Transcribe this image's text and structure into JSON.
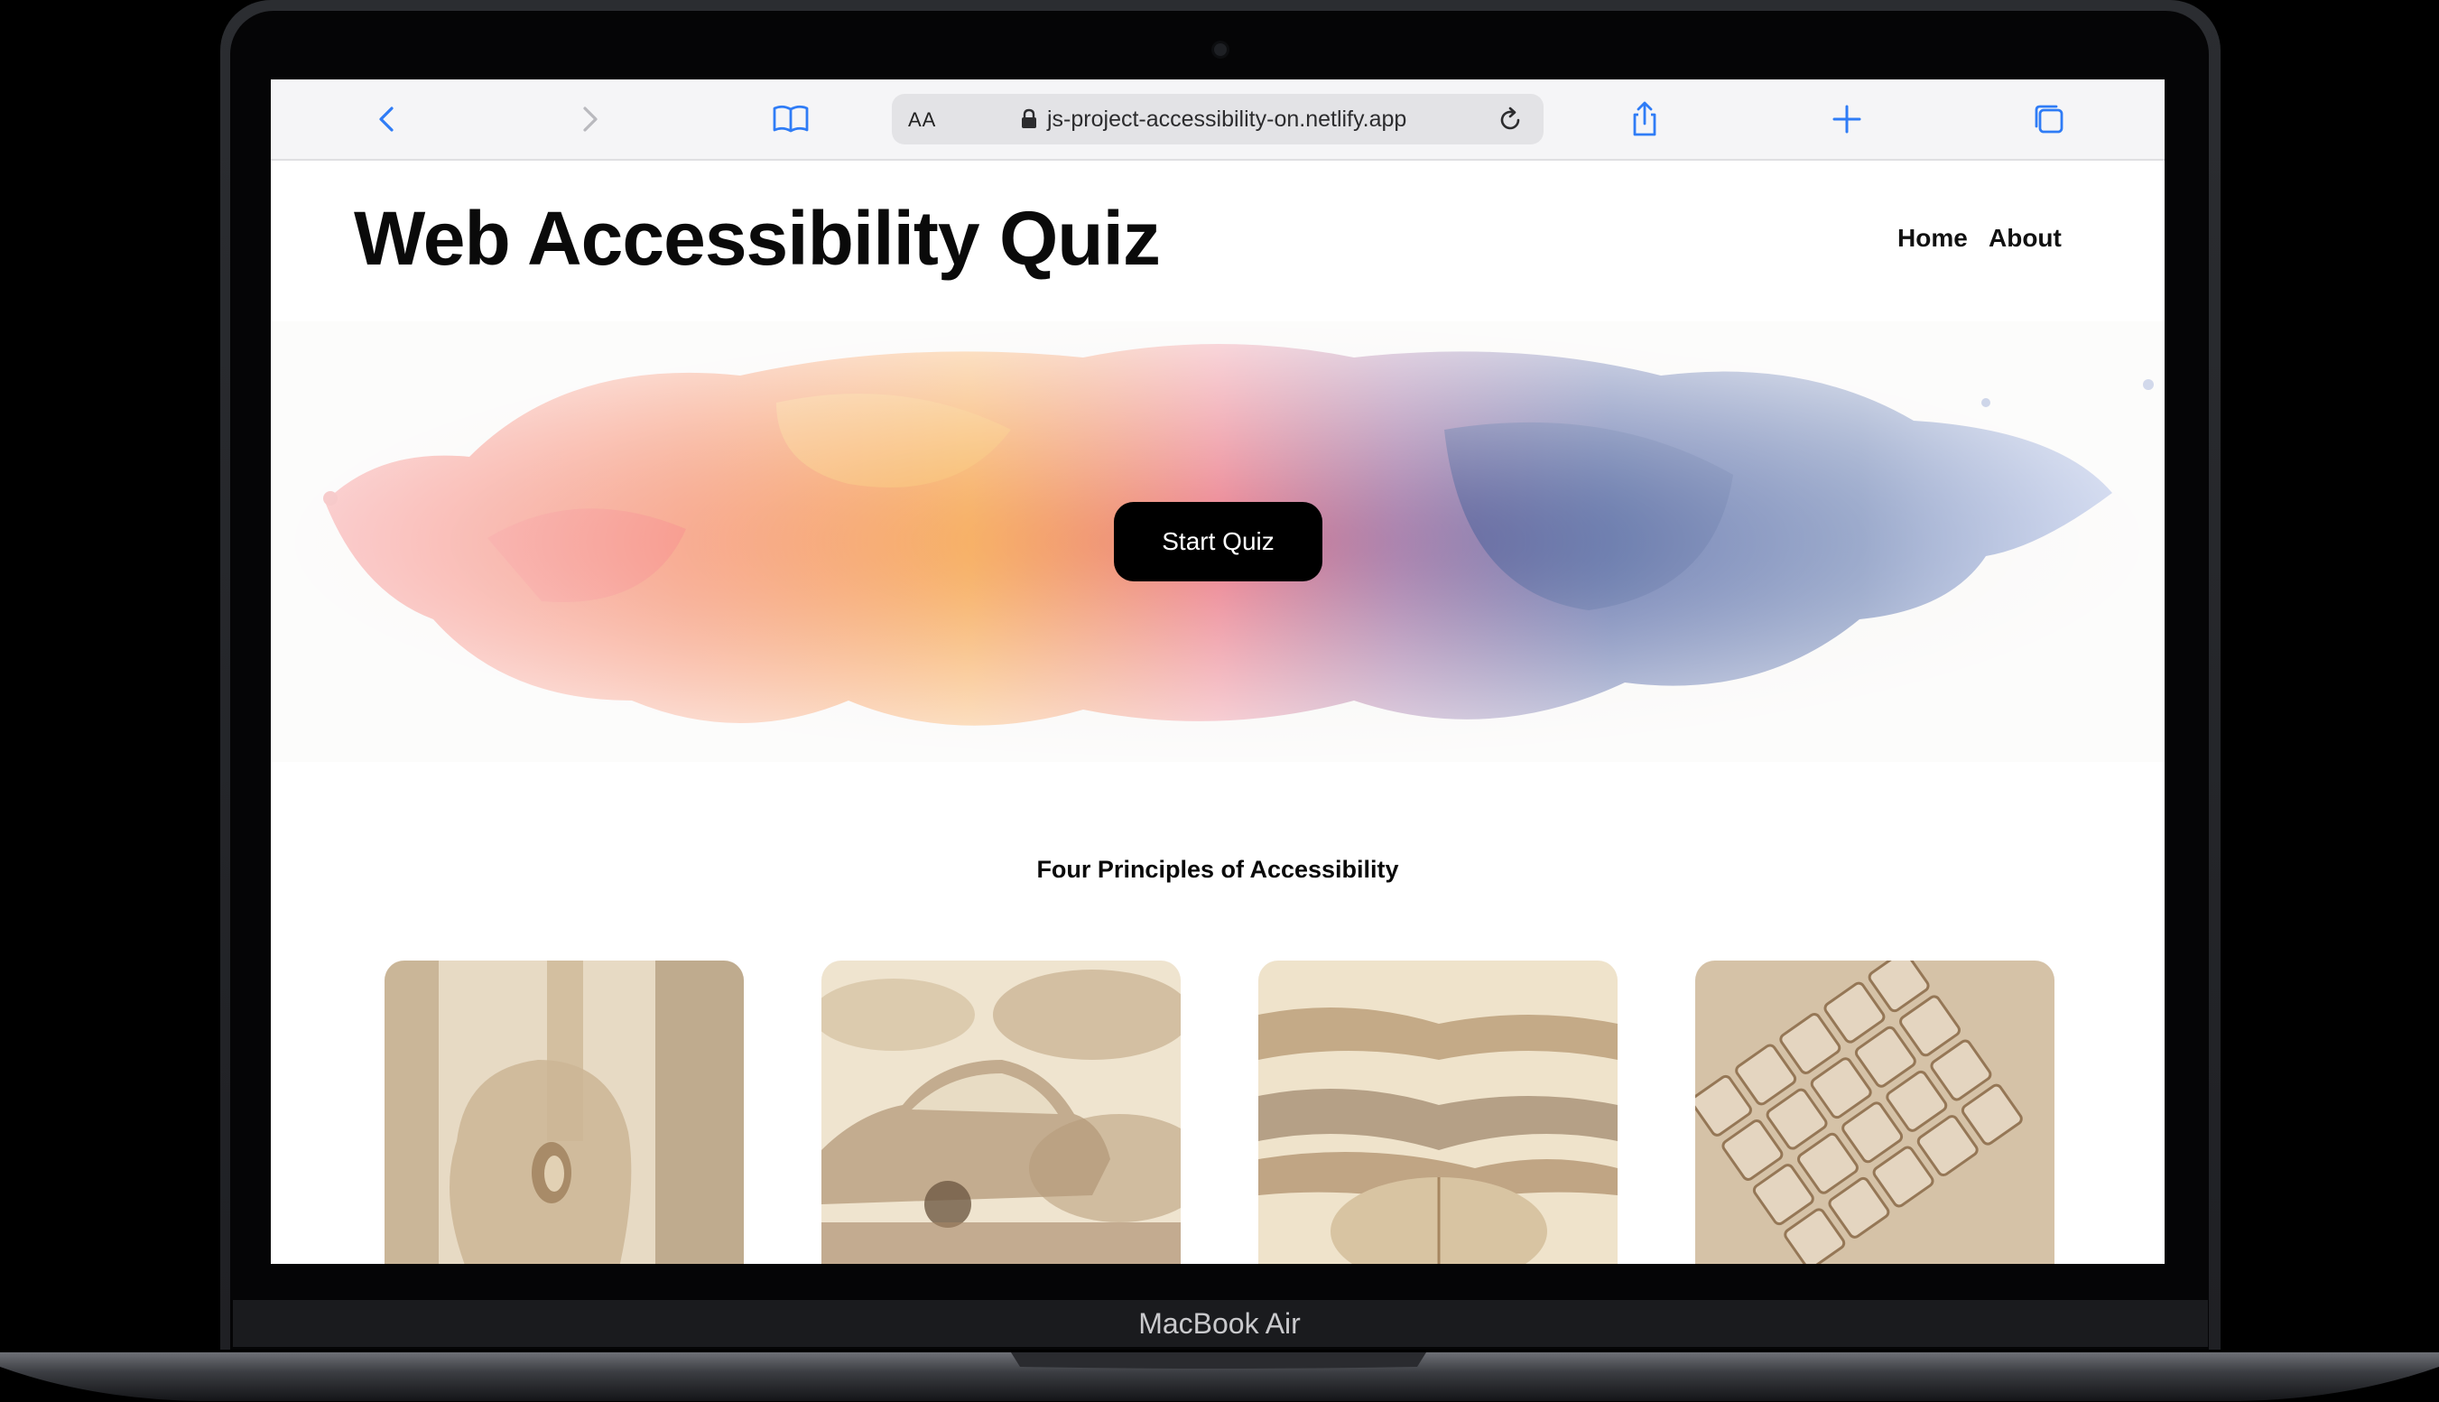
{
  "device": {
    "label": "MacBook Air"
  },
  "browser": {
    "text_size_label": "AA",
    "url": "js-project-accessibility-on.netlify.app",
    "icons": [
      "back-icon",
      "forward-icon",
      "bookmarks-icon",
      "lock-icon",
      "reload-icon",
      "share-icon",
      "new-tab-icon",
      "tabs-icon"
    ]
  },
  "site": {
    "title": "Web Accessibility Quiz",
    "nav": {
      "home": "Home",
      "about": "About"
    },
    "hero": {
      "button_label": "Start Quiz"
    },
    "section": {
      "heading": "Four Principles of Accessibility"
    }
  },
  "colors": {
    "accent": "#2f7cf6",
    "button_bg": "#000000",
    "text": "#0a0a0a"
  }
}
